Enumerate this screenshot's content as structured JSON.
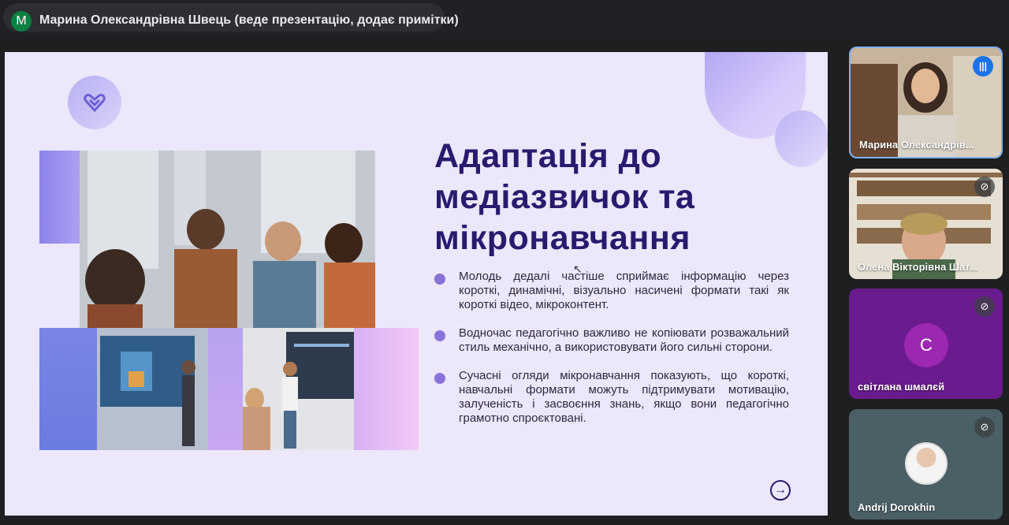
{
  "presenter_bar": {
    "avatar_letter": "M",
    "text": "Марина Олександрівна Швець (веде презентацію, додає примітки)"
  },
  "slide": {
    "title": "Адаптація до медіазвичок та мікронавчання",
    "bullets": [
      "Молодь дедалі частіше сприймає інформацію через короткі, динамічні, візуально насичені формати такі як короткі відео, мікроконтент.",
      "Водночас педагогічно важливо не копіювати розважальний стиль механічно, а використовувати його сильні сторони.",
      "Сучасні огляди мікронавчання показують, що короткі, навчальні формати можуть підтримувати мотивацію, залученість і засвоєння знань, якщо вони педагогічно грамотно спроєктовані."
    ],
    "next_icon": "arrow-right-circle-icon",
    "accent_color": "#2a1a6e"
  },
  "participants": [
    {
      "name": "Марина Олександрів...",
      "status_icon": "speaking-icon"
    },
    {
      "name": "Олена Вікторівна Шат...",
      "status_icon": "mic-off-icon"
    },
    {
      "name": "світлана шмалєй",
      "avatar_letter": "С",
      "status_icon": "mic-off-icon"
    },
    {
      "name": "Andrij Dorokhin",
      "status_icon": "mic-off-icon"
    }
  ]
}
